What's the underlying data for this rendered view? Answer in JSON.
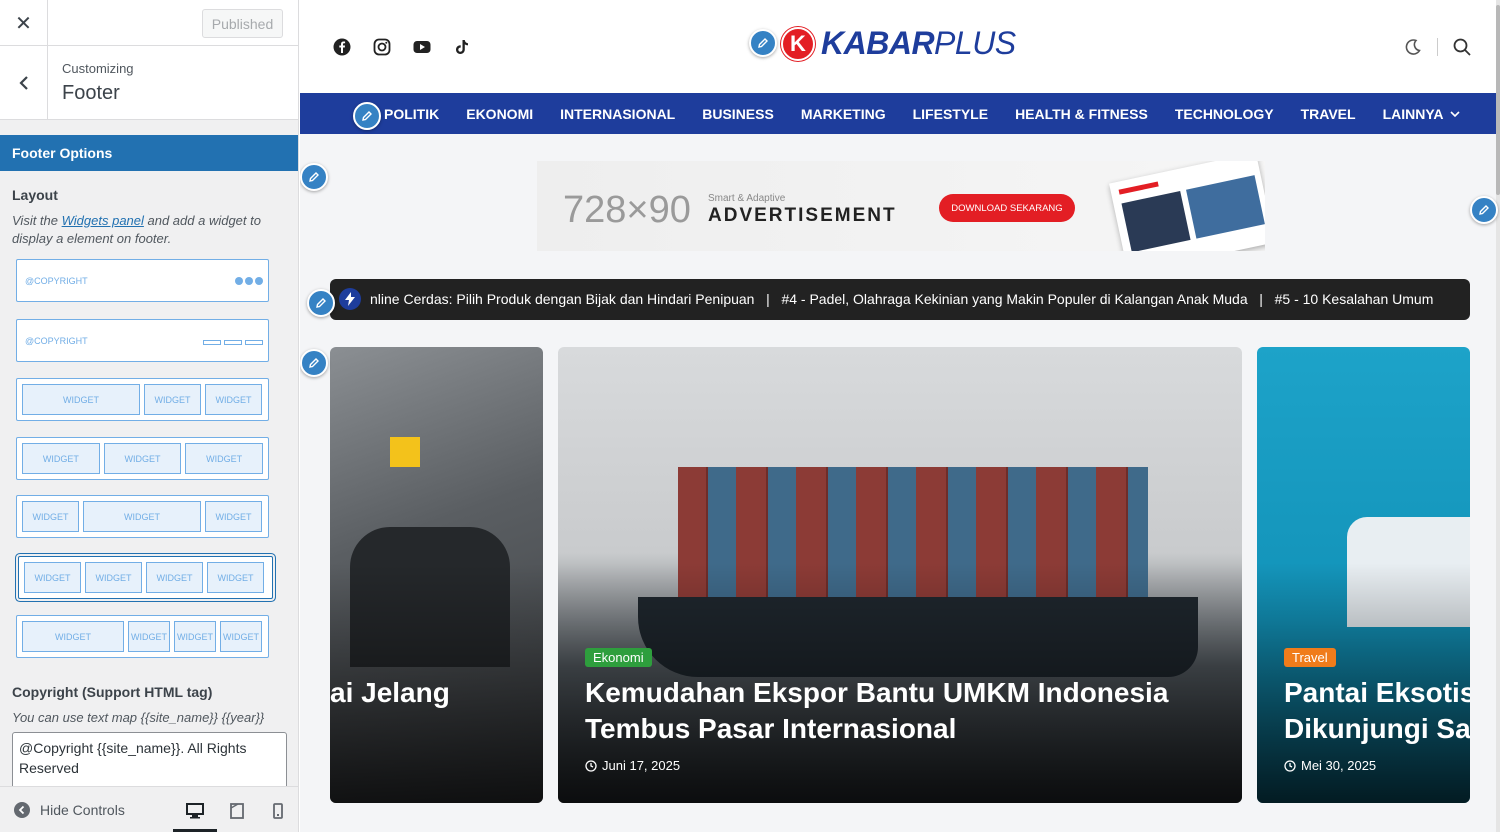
{
  "sidebar": {
    "close_label": "✕",
    "publish_label": "Published",
    "customizing_label": "Customizing",
    "section_title": "Footer",
    "panel_header": "Footer Options",
    "layout_label": "Layout",
    "layout_desc_pre": "Visit the ",
    "layout_desc_link": "Widgets panel",
    "layout_desc_post": " and add a widget to display a element on footer.",
    "copyright_tag": "@COPYRIGHT",
    "widget_label": "WIDGET",
    "copyright_label": "Copyright (Support HTML tag)",
    "copyright_desc": "You can use text map {{site_name}} {{year}}",
    "copyright_value": "@Copyright {{site_name}}. All Rights Reserved",
    "hide_controls": "Hide Controls",
    "accent_color": "#2271b1"
  },
  "site": {
    "logo_letter": "K",
    "logo_main": "KABAR",
    "logo_plus": "PLUS",
    "nav": [
      "POLITIK",
      "EKONOMI",
      "INTERNASIONAL",
      "BUSINESS",
      "MARKETING",
      "LIFESTYLE",
      "HEALTH & FITNESS",
      "TECHNOLOGY",
      "TRAVEL",
      "LAINNYA"
    ],
    "ad": {
      "size": "728×90",
      "small": "Smart & Adaptive",
      "big": "ADVERTISEMENT",
      "button": "DOWNLOAD SEKARANG"
    },
    "ticker": "nline Cerdas: Pilih Produk dengan Bijak dan Hindari Penipuan   |   #4 - Padel, Olahraga Kekinian yang Makin Populer di Kalangan Anak Muda   |   #5 - 10 Kesalahan Umum",
    "cards": [
      {
        "title": "ai Jelang",
        "category": "",
        "date": ""
      },
      {
        "title1": "Kemudahan Ekspor Bantu UMKM Indonesia",
        "title2": "Tembus Pasar Internasional",
        "category": "Ekonomi",
        "date": "Juni 17, 2025",
        "badge_color": "#2e9e3d"
      },
      {
        "title1": "Pantai Eksotis",
        "title2": "Dikunjungi Sa",
        "category": "Travel",
        "date": "Mei 30, 2025",
        "badge_color": "#f07c1b"
      }
    ],
    "brand_color": "#1e3d9c"
  }
}
